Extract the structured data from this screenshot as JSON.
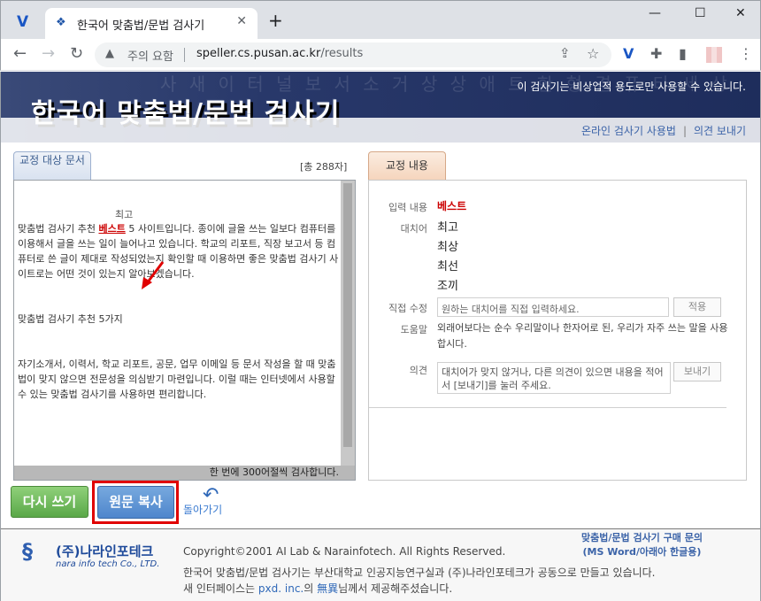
{
  "browser": {
    "tab_title": "한국어 맞춤법/문법 검사기",
    "tab_close": "✕",
    "new_tab": "+",
    "security_warning": "주의 요함",
    "url_host": "speller.cs.pusan.ac.kr",
    "url_path": "/results",
    "controls": {
      "minimize": "—",
      "maximize": "☐",
      "close": "✕"
    }
  },
  "banner": {
    "title": "한국어 맞춤법/문법 검사기",
    "notice": "이 검사기는 비상업적 용도로만 사용할 수 있습니다.",
    "bg_chars": "사 새 이 터 널 보 서 소 거 상 상 애 트 한 형 겸 퓨 타 세 상",
    "links": [
      {
        "label": "온라인 검사기 사용법"
      },
      {
        "label": "의견 보내기"
      }
    ]
  },
  "left": {
    "tab_label": "교정 대상 문서",
    "char_count": "[총 288자]",
    "suggestion": "최고",
    "p1_before": "맞춤법 검사기 추천 ",
    "p1_error": "베스트",
    "p1_after": " 5 사이트입니다. 종이에 글을 쓰는 일보다 컴퓨터를 이용해서 글을 쓰는 일이 늘어나고 있습니다. 학교의 리포트, 직장 보고서 등 컴퓨터로 쓴 글이 제대로 작성되었는지 확인할 때 이용하면 좋은 맞춤법 검사기 사이트로는 어떤 것이 있는지 알아보겠습니다.",
    "p2": "맞춤법 검사기 추천 5가지",
    "p3": "자기소개서, 이력서, 학교 리포트, 공문, 업무 이메일 등 문서 작성을 할 때 맞춤법이 맞지 않으면 전문성을 의심받기 마련입니다. 이럴 때는 인터넷에서 사용할 수 있는 맞춤법 검사기를 사용하면 편리합니다.",
    "footer": "한 번에 300어절씩 검사합니다."
  },
  "right": {
    "tab_label": "교정 내용",
    "input_label": "입력 내용",
    "input_value": "베스트",
    "replace_label": "대치어",
    "candidates": [
      "최고",
      "최상",
      "최선",
      "조끼"
    ],
    "direct_label": "직접 수정",
    "direct_placeholder": "원하는 대치어를 직접 입력하세요.",
    "apply_label": "적용",
    "help_label": "도움말",
    "help_text": "외래어보다는 순수 우리말이나 한자어로 된, 우리가 자주 쓰는 말을 사용합시다.",
    "opinion_label": "의견",
    "opinion_placeholder": "대치어가 맞지 않거나, 다른 의견이 있으면 내용을 적어서 [보내기]를 눌러 주세요.",
    "send_label": "보내기"
  },
  "buttons": {
    "retry": "다시 쓰기",
    "copy": "원문 복사",
    "back": "돌아가기"
  },
  "footer": {
    "corp_name": "(주)나라인포테크",
    "corp_en": "nara info tech Co., LTD.",
    "copyright": "Copyright©2001 AI Lab & Narainfotech. All Rights Reserved.",
    "desc": "한국어 맞춤법/문법 검사기는 부산대학교 인공지능연구실과 (주)나라인포테크가 공동으로 만들고 있습니다.",
    "desc2_before": "새 인터페이스는 ",
    "desc2_link1": "pxd. inc.",
    "desc2_mid": "의 ",
    "desc2_link2": "無異",
    "desc2_after": "님께서 제공해주셨습니다.",
    "purchase_line1": "맞춤법/문법 검사기 구매 문의",
    "purchase_line2": "(MS Word/아래아 한글용)"
  },
  "colors": {
    "banner_bg": "#28386a",
    "error_red": "#cc0000",
    "highlight_outline": "#e00000",
    "retry_green": "#5aa848",
    "copy_blue": "#4e86cc",
    "link_blue": "#3b63a8"
  },
  "icons": {
    "app": "chrome-v-icon",
    "favicon": "speller-favicon",
    "back": "curved-arrow-left-icon",
    "annotation": "red-arrow-icon"
  }
}
